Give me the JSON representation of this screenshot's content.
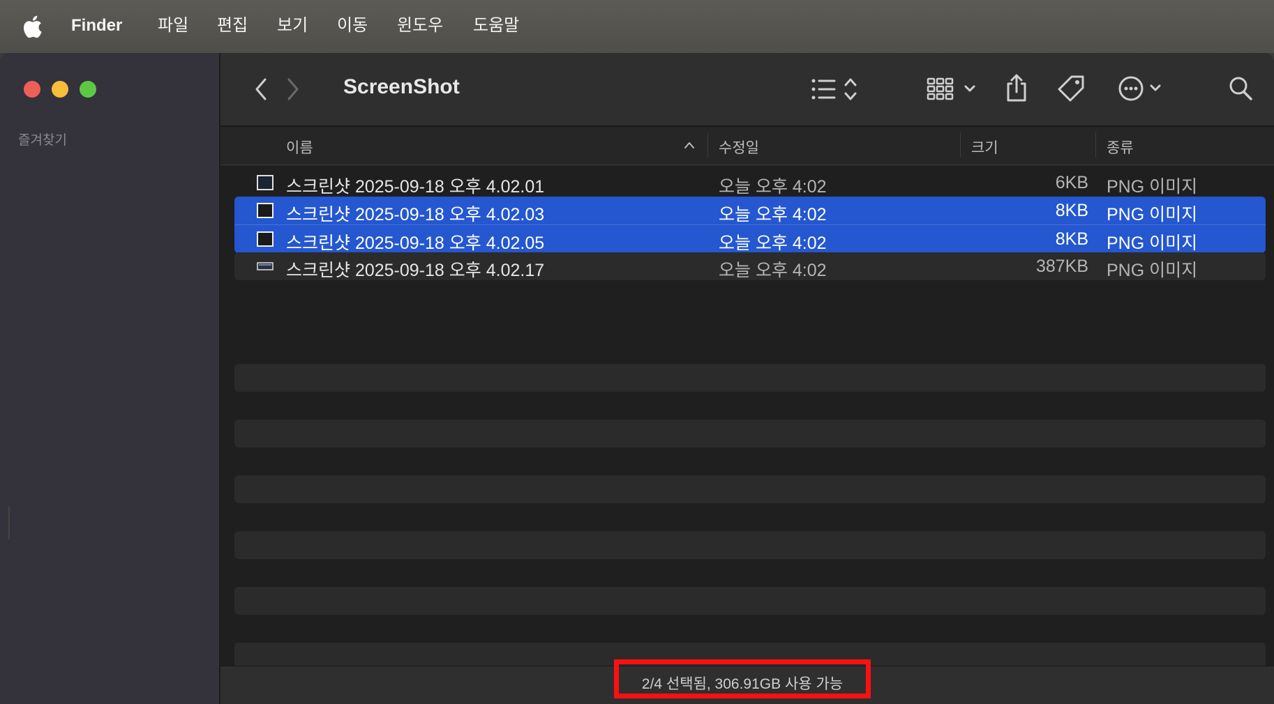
{
  "menubar": {
    "app_name": "Finder",
    "items": [
      "파일",
      "편집",
      "보기",
      "이동",
      "윈도우",
      "도움말"
    ]
  },
  "sidebar": {
    "section_label": "즐겨찾기"
  },
  "toolbar": {
    "title": "ScreenShot",
    "icons": [
      "back-icon",
      "forward-icon",
      "list-view-icon",
      "group-icon",
      "share-icon",
      "tag-icon",
      "more-icon",
      "search-icon"
    ]
  },
  "columns": {
    "name": "이름",
    "modified": "수정일",
    "size": "크기",
    "kind": "종류"
  },
  "files": [
    {
      "name": "스크린샷 2025-09-18 오후 4.02.01",
      "modified": "오늘 오후 4:02",
      "size": "6KB",
      "kind": "PNG 이미지",
      "selected": false
    },
    {
      "name": "스크린샷 2025-09-18 오후 4.02.03",
      "modified": "오늘 오후 4:02",
      "size": "8KB",
      "kind": "PNG 이미지",
      "selected": true
    },
    {
      "name": "스크린샷 2025-09-18 오후 4.02.05",
      "modified": "오늘 오후 4:02",
      "size": "8KB",
      "kind": "PNG 이미지",
      "selected": true
    },
    {
      "name": "스크린샷 2025-09-18 오후 4.02.17",
      "modified": "오늘 오후 4:02",
      "size": "387KB",
      "kind": "PNG 이미지",
      "selected": false
    }
  ],
  "status": {
    "text": "2/4 선택됨, 306.91GB 사용 가능"
  },
  "colors": {
    "selection": "#2457d0",
    "highlight_box": "#ff1010"
  }
}
